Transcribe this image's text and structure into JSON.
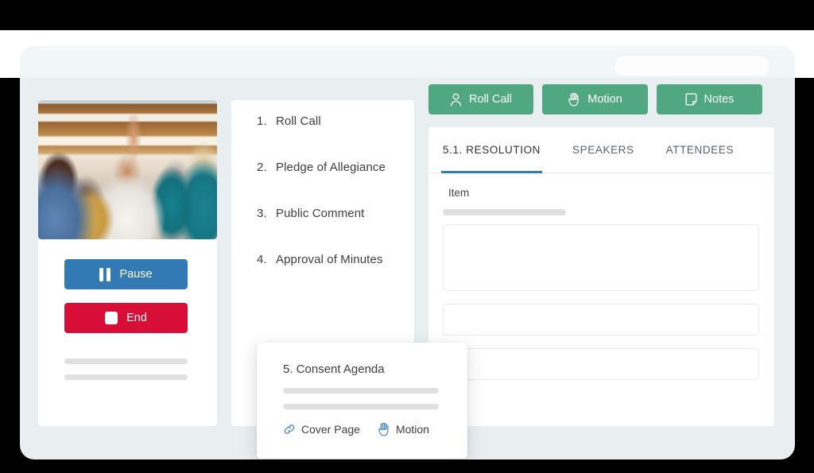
{
  "header": {
    "search_pill": ""
  },
  "left_panel": {
    "photo_alt": "meeting-attendees-photo",
    "pause_label": "Pause",
    "end_label": "End",
    "pause_color": "#3379b4",
    "end_color": "#d70f37"
  },
  "agenda": {
    "items": [
      {
        "number": "1.",
        "label": "Roll Call"
      },
      {
        "number": "2.",
        "label": "Pledge of Allegiance"
      },
      {
        "number": "3.",
        "label": "Public Comment"
      },
      {
        "number": "4.",
        "label": "Approval of Minutes"
      }
    ]
  },
  "actions": {
    "accent_color": "#50a881",
    "buttons": [
      {
        "label": "Roll Call",
        "icon": "person-icon"
      },
      {
        "label": "Motion",
        "icon": "raised-hand-icon"
      },
      {
        "label": "Notes",
        "icon": "note-icon"
      }
    ]
  },
  "detail_panel": {
    "tabs": [
      {
        "label": "5.1. RESOLUTION",
        "active": true
      },
      {
        "label": "SPEAKERS",
        "active": false
      },
      {
        "label": "ATTENDEES",
        "active": false
      }
    ],
    "active_tab_color": "#3379b4",
    "field_label": "Item"
  },
  "popup": {
    "title": "5. Consent Agenda",
    "links": [
      {
        "label": "Cover Page",
        "icon": "link-icon"
      },
      {
        "label": "Motion",
        "icon": "raised-hand-icon"
      }
    ]
  }
}
